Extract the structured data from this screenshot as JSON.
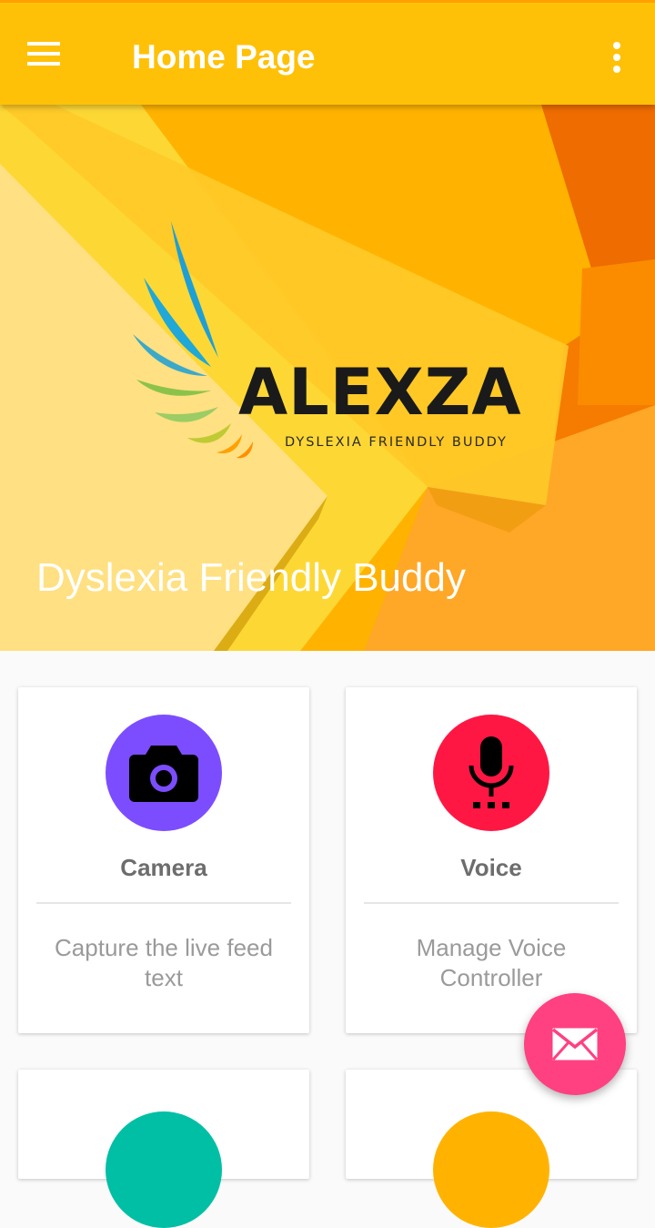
{
  "app_bar": {
    "title": "Home Page",
    "menu_icon": "hamburger-menu-icon",
    "overflow_icon": "more-vertical-icon",
    "color": "#ffc107"
  },
  "header": {
    "logo": {
      "name": "ALEXZA",
      "tagline": "DYSLEXIA FRIENDLY BUDDY"
    },
    "title": "Dyslexia Friendly Buddy"
  },
  "cards": [
    {
      "title": "Camera",
      "description": "Capture the live feed text",
      "icon": "camera-icon",
      "color": "#7c4dff"
    },
    {
      "title": "Voice",
      "description": "Manage Voice Controller",
      "icon": "microphone-icon",
      "color": "#ff1744"
    },
    {
      "color": "#00bfa5"
    },
    {
      "color": "#ffb300"
    }
  ],
  "fab": {
    "icon": "email-icon",
    "color": "#ff4081"
  }
}
